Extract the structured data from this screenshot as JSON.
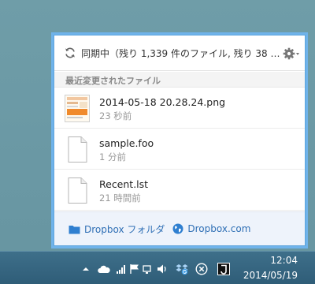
{
  "header": {
    "sync_status": "同期中（残り 1,339 件のファイル, 残り 38 …"
  },
  "recent": {
    "section_label": "最近変更されたファイル",
    "files": [
      {
        "name": "2014-05-18 20.28.24.png",
        "time": "23 秒前",
        "icon": "image-thumbnail"
      },
      {
        "name": "sample.foo",
        "time": "1 分前",
        "icon": "file-icon"
      },
      {
        "name": "Recent.lst",
        "time": "21 時間前",
        "icon": "file-icon"
      }
    ]
  },
  "footer": {
    "folder_link": "Dropbox フォルダ",
    "web_link": "Dropbox.com"
  },
  "taskbar": {
    "time": "12:04",
    "date": "2014/05/19"
  },
  "colors": {
    "popup_border": "#6fb3ea",
    "link": "#2f6fb5",
    "taskbar": "#2f5d78"
  }
}
